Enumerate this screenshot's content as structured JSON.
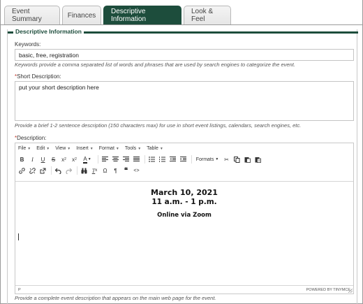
{
  "tabs": [
    {
      "label": "Event Summary",
      "active": false
    },
    {
      "label": "Finances",
      "active": false
    },
    {
      "label": "Descriptive Information",
      "active": true
    },
    {
      "label": "Look & Feel",
      "active": false
    }
  ],
  "section": {
    "legend": "Descriptive Information"
  },
  "keywords": {
    "label": "Keywords:",
    "value": "basic, free, registration",
    "hint": "Keywords provide a comma separated list of words and phrases that are used by search engines to categorize the event."
  },
  "short_description": {
    "required_mark": "*",
    "label": "Short Description:",
    "value": "put your short description here",
    "hint": "Provide a brief 1-2 sentence description (150 characters max) for use in short event listings, calendars, search engines, etc."
  },
  "description": {
    "required_mark": "*",
    "label": "Description:",
    "hint": "Provide a complete event description that appears on the main web page for the event."
  },
  "editor": {
    "menus": [
      "File",
      "Edit",
      "View",
      "Insert",
      "Format",
      "Tools",
      "Table"
    ],
    "formats_label": "Formats",
    "content": {
      "date": "March 10, 2021",
      "time": "11 a.m. - 1 p.m.",
      "location": "Online via Zoom"
    },
    "status_path": "P",
    "powered_by": "POWERED BY TINYMCE"
  },
  "colors": {
    "accent": "#1d4d3c",
    "required": "#c0392b"
  }
}
